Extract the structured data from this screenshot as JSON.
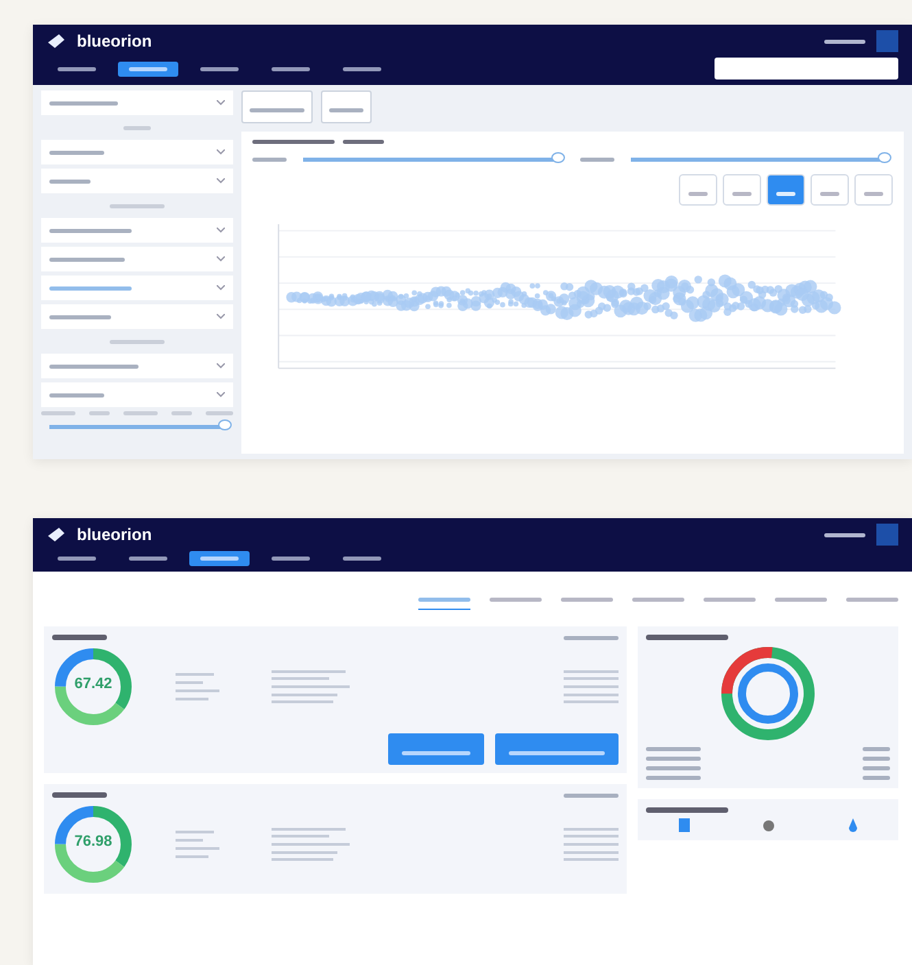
{
  "top_screen": {
    "logo": "blueorion",
    "nav_tabs": [
      {
        "selected": false
      },
      {
        "selected": true
      },
      {
        "selected": false
      },
      {
        "selected": false
      },
      {
        "selected": false
      }
    ],
    "sliders": [
      {
        "level": 1
      },
      {
        "level": 1
      }
    ],
    "range_buttons": [
      {
        "selected": false
      },
      {
        "selected": false
      },
      {
        "selected": true
      },
      {
        "selected": false
      },
      {
        "selected": false
      }
    ],
    "sidebar_slider": {
      "level": 1
    }
  },
  "bottom_screen": {
    "logo": "blueorion",
    "nav_tabs": [
      {
        "selected": false
      },
      {
        "selected": false
      },
      {
        "selected": true
      },
      {
        "selected": false
      },
      {
        "selected": false
      }
    ],
    "sub_tabs": [
      {
        "selected": true
      },
      {
        "selected": false
      },
      {
        "selected": false
      },
      {
        "selected": false
      },
      {
        "selected": false
      },
      {
        "selected": false
      },
      {
        "selected": false
      }
    ],
    "score_cards": [
      {
        "score": "67.42"
      },
      {
        "score": "76.98"
      }
    ]
  }
}
